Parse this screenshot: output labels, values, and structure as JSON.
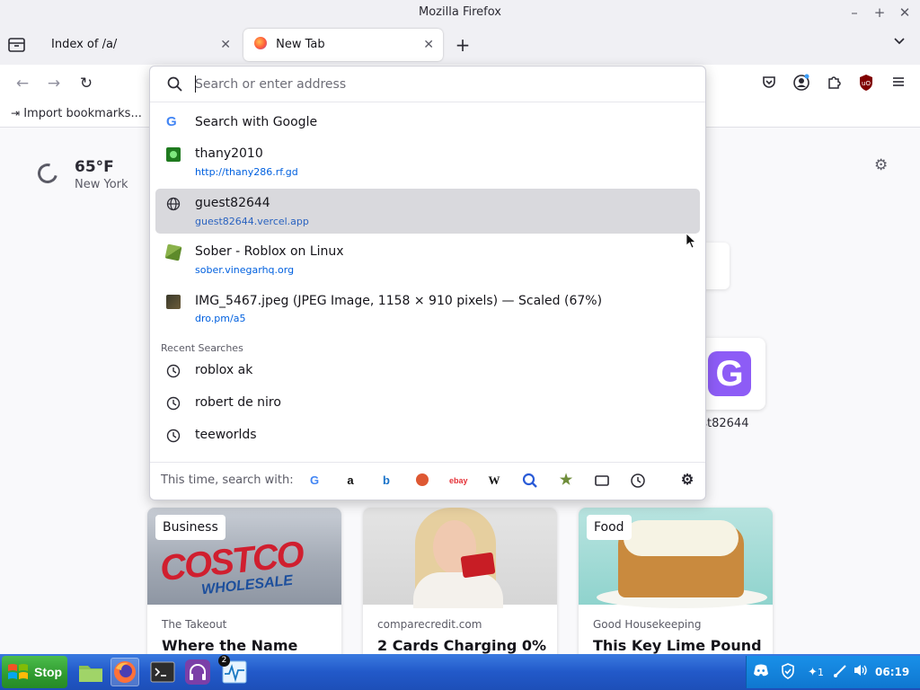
{
  "window": {
    "title": "Mozilla Firefox"
  },
  "tabs": [
    {
      "label": "Index of /a/",
      "active": false
    },
    {
      "label": "New Tab",
      "active": true
    }
  ],
  "bookmarks": {
    "import_label": "Import bookmarks..."
  },
  "urlbar": {
    "placeholder": "Search or enter address",
    "value": "",
    "suggestions": [
      {
        "title": "Search with Google",
        "url": "",
        "icon": "google-icon"
      },
      {
        "title": "thany2010",
        "url": "http://thany286.rf.gd",
        "icon": "thany-favicon"
      },
      {
        "title": "guest82644",
        "url": "guest82644.vercel.app",
        "icon": "globe-icon",
        "selected": true
      },
      {
        "title": "Sober - Roblox on Linux",
        "url": "sober.vinegarhq.org",
        "icon": "sober-favicon"
      },
      {
        "title": "IMG_5467.jpeg (JPEG Image, 1158 × 910 pixels) — Scaled (67%)",
        "url": "dro.pm/a5",
        "icon": "image-thumbnail"
      }
    ],
    "recent_label": "Recent Searches",
    "recent": [
      "roblox ak",
      "robert de niro",
      "teeworlds"
    ],
    "footer_label": "This time, search with:",
    "engines": [
      "google",
      "amazon",
      "bing",
      "duckduckgo",
      "ebay",
      "wikipedia",
      "search",
      "bookmarks",
      "tabs",
      "history",
      "settings"
    ]
  },
  "newtab": {
    "weather": {
      "temp": "65°F",
      "city": "New York"
    },
    "shortcut": {
      "label": "uest82644"
    },
    "stories": [
      {
        "tag": "Business",
        "source": "The Takeout",
        "headline": "Where the Name"
      },
      {
        "tag": "",
        "source": "comparecredit.com",
        "headline": "2 Cards Charging 0%"
      },
      {
        "tag": "Food",
        "source": "Good Housekeeping",
        "headline": "This Key Lime Pound"
      }
    ]
  },
  "taskbar": {
    "start_label": "Stop",
    "badge": "2",
    "tray_count": "1",
    "clock": "06:19"
  },
  "colors": {
    "accent": "#0060df",
    "selected_row": "#d9d9dd",
    "taskbar": "#2259c9",
    "start": "#2f9a2f"
  }
}
